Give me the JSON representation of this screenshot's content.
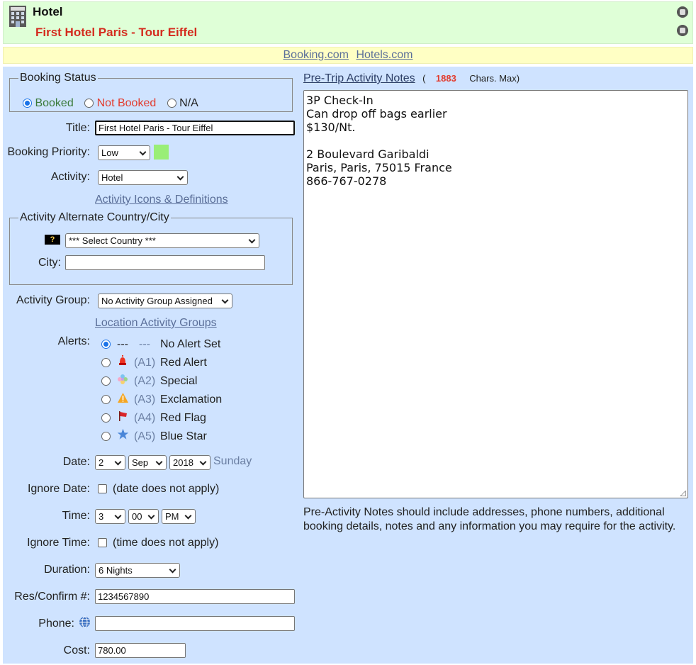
{
  "header": {
    "category": "Hotel",
    "hotel_name": "First Hotel Paris - Tour Eiffel",
    "icon_colors": {
      "hotel_icon": "#4a4a4a",
      "name_color": "#d42b1e"
    }
  },
  "links": {
    "booking": "Booking.com",
    "hotels": "Hotels.com"
  },
  "booking_status": {
    "legend": "Booking Status",
    "options": [
      {
        "label": "Booked",
        "checked": true
      },
      {
        "label": "Not Booked",
        "checked": false
      },
      {
        "label": "N/A",
        "checked": false
      }
    ]
  },
  "form": {
    "title_label": "Title:",
    "title_value": "First Hotel Paris - Tour Eiffel",
    "priority_label": "Booking Priority:",
    "priority_value": "Low",
    "priority_color": "#99ee77",
    "activity_label": "Activity:",
    "activity_value": "Hotel",
    "activity_link": "Activity Icons & Definitions",
    "alt_legend": "Activity Alternate Country/City",
    "help_badge": "?",
    "country_value": "*** Select Country ***",
    "city_label": "City:",
    "city_value": "",
    "group_label": "Activity Group:",
    "group_value": "No Activity Group Assigned",
    "group_link": "Location Activity Groups",
    "alerts_label": "Alerts:",
    "alerts": [
      {
        "code": "---",
        "icon": "none",
        "icon_text": "---",
        "label": "No Alert Set",
        "checked": true
      },
      {
        "code": "(A1)",
        "icon": "red-alert-icon",
        "icon_text": "",
        "label": "Red Alert",
        "checked": false
      },
      {
        "code": "(A2)",
        "icon": "special-icon",
        "icon_text": "",
        "label": "Special",
        "checked": false
      },
      {
        "code": "(A3)",
        "icon": "exclamation-icon",
        "icon_text": "",
        "label": "Exclamation",
        "checked": false
      },
      {
        "code": "(A4)",
        "icon": "red-flag-icon",
        "icon_text": "",
        "label": "Red Flag",
        "checked": false
      },
      {
        "code": "(A5)",
        "icon": "blue-star-icon",
        "icon_text": "",
        "label": "Blue Star",
        "checked": false
      }
    ],
    "date_label": "Date:",
    "date_day": "2",
    "date_month": "Sep",
    "date_year": "2018",
    "date_weekday": "Sunday",
    "ignore_date_label": "Ignore Date:",
    "ignore_date_note": "(date does not apply)",
    "time_label": "Time:",
    "time_hour": "3",
    "time_minute": "00",
    "time_ampm": "PM",
    "ignore_time_label": "Ignore Time:",
    "ignore_time_note": "(time does not apply)",
    "duration_label": "Duration:",
    "duration_value": "6 Nights",
    "res_label": "Res/Confirm #:",
    "res_value": "1234567890",
    "phone_label": "Phone:",
    "phone_value": "",
    "cost_label": "Cost:",
    "cost_value": "780.00"
  },
  "notes": {
    "heading": "Pre-Trip Activity Notes",
    "open_paren": "(",
    "chars_count": "1883",
    "chars_text": "Chars. Max)",
    "lines": [
      "3P Check-In",
      "Can drop off bags earlier",
      "$130/Nt.",
      "",
      "2 Boulevard Garibaldi",
      "Paris, Paris, 75015 France",
      "866-767-0278"
    ],
    "help_text": "Pre-Activity Notes should include addresses, phone numbers, additional booking details, notes and any information you may require for the activity."
  }
}
